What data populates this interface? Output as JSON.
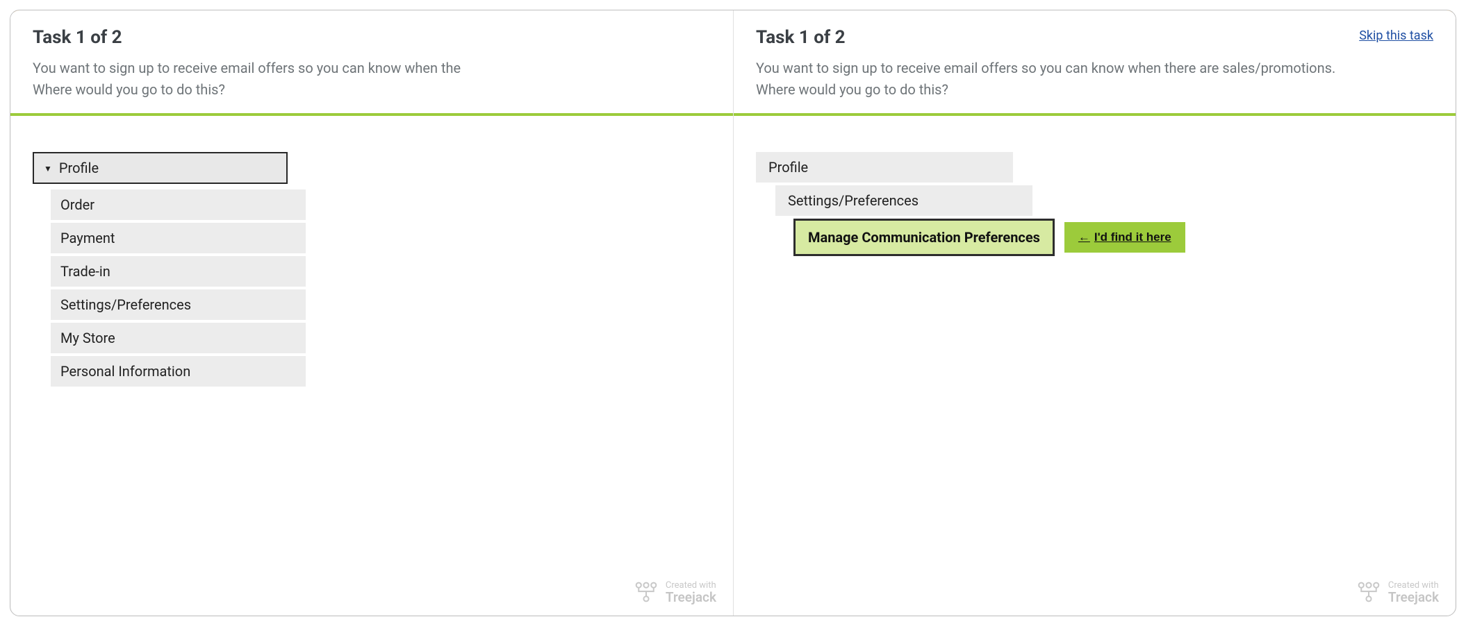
{
  "task": {
    "title": "Task 1 of 2",
    "prompt_full": "You want to sign up to receive email offers so you can know when there are sales/promotions.\nWhere would you go to do this?",
    "prompt_clipped": "You want to sign up to receive email offers so you can know when the\nWhere would you go to do this?",
    "skip_label": "Skip this task"
  },
  "left_tree": {
    "root": "Profile",
    "children": [
      "Order",
      "Payment",
      "Trade-in",
      "Settings/Preferences",
      "My Store",
      "Personal Information"
    ]
  },
  "right_path": {
    "levels": [
      "Profile",
      "Settings/Preferences",
      "Manage Communication Preferences"
    ],
    "find_button": "I'd find it here"
  },
  "footer": {
    "created": "Created with",
    "product": "Treejack"
  }
}
